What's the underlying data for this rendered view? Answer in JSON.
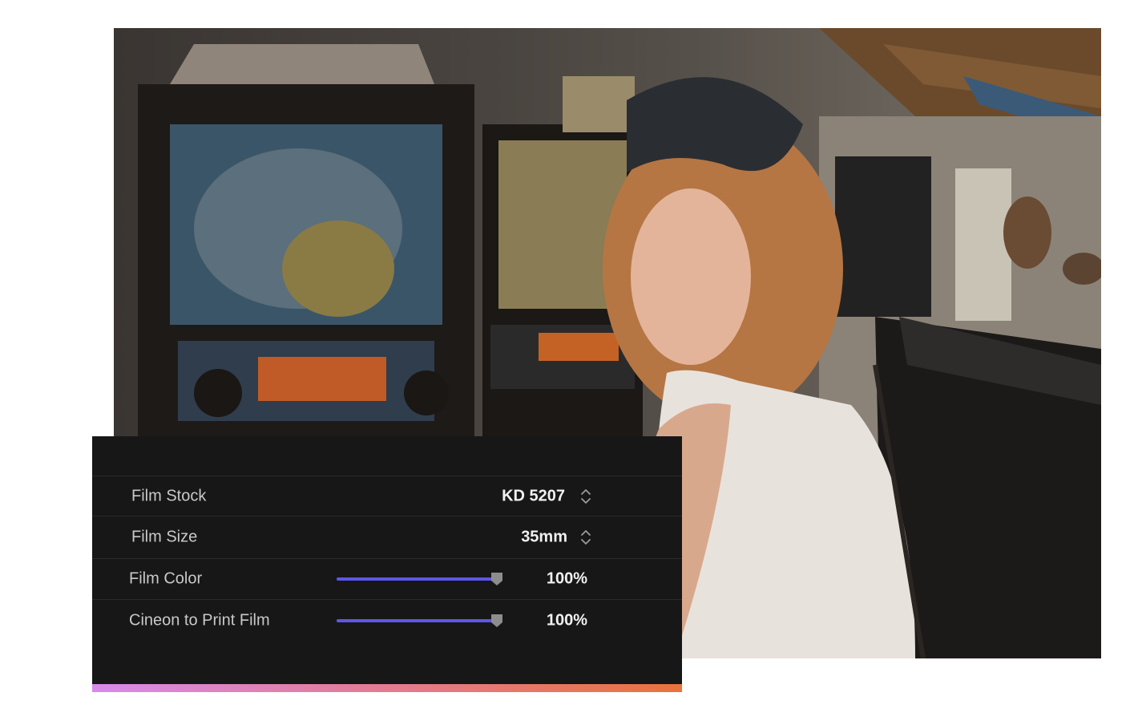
{
  "panel": {
    "rows": [
      {
        "label": "Film Stock",
        "value": "KD 5207",
        "control": "stepper"
      },
      {
        "label": "Film Size",
        "value": "35mm",
        "control": "stepper"
      },
      {
        "label": "Film Color",
        "value": "100%",
        "control": "slider",
        "level": 1.0
      },
      {
        "label": "Cineon to Print Film",
        "value": "100%",
        "control": "slider",
        "level": 1.0
      }
    ]
  },
  "colors": {
    "panel_bg": "#171717",
    "slider_accent": "#5b57e8",
    "gradient_start": "#d88bea",
    "gradient_end": "#e9733d"
  },
  "icons": {
    "stepper": "chevron-up-down-icon",
    "slider_thumb": "slider-thumb-icon"
  }
}
